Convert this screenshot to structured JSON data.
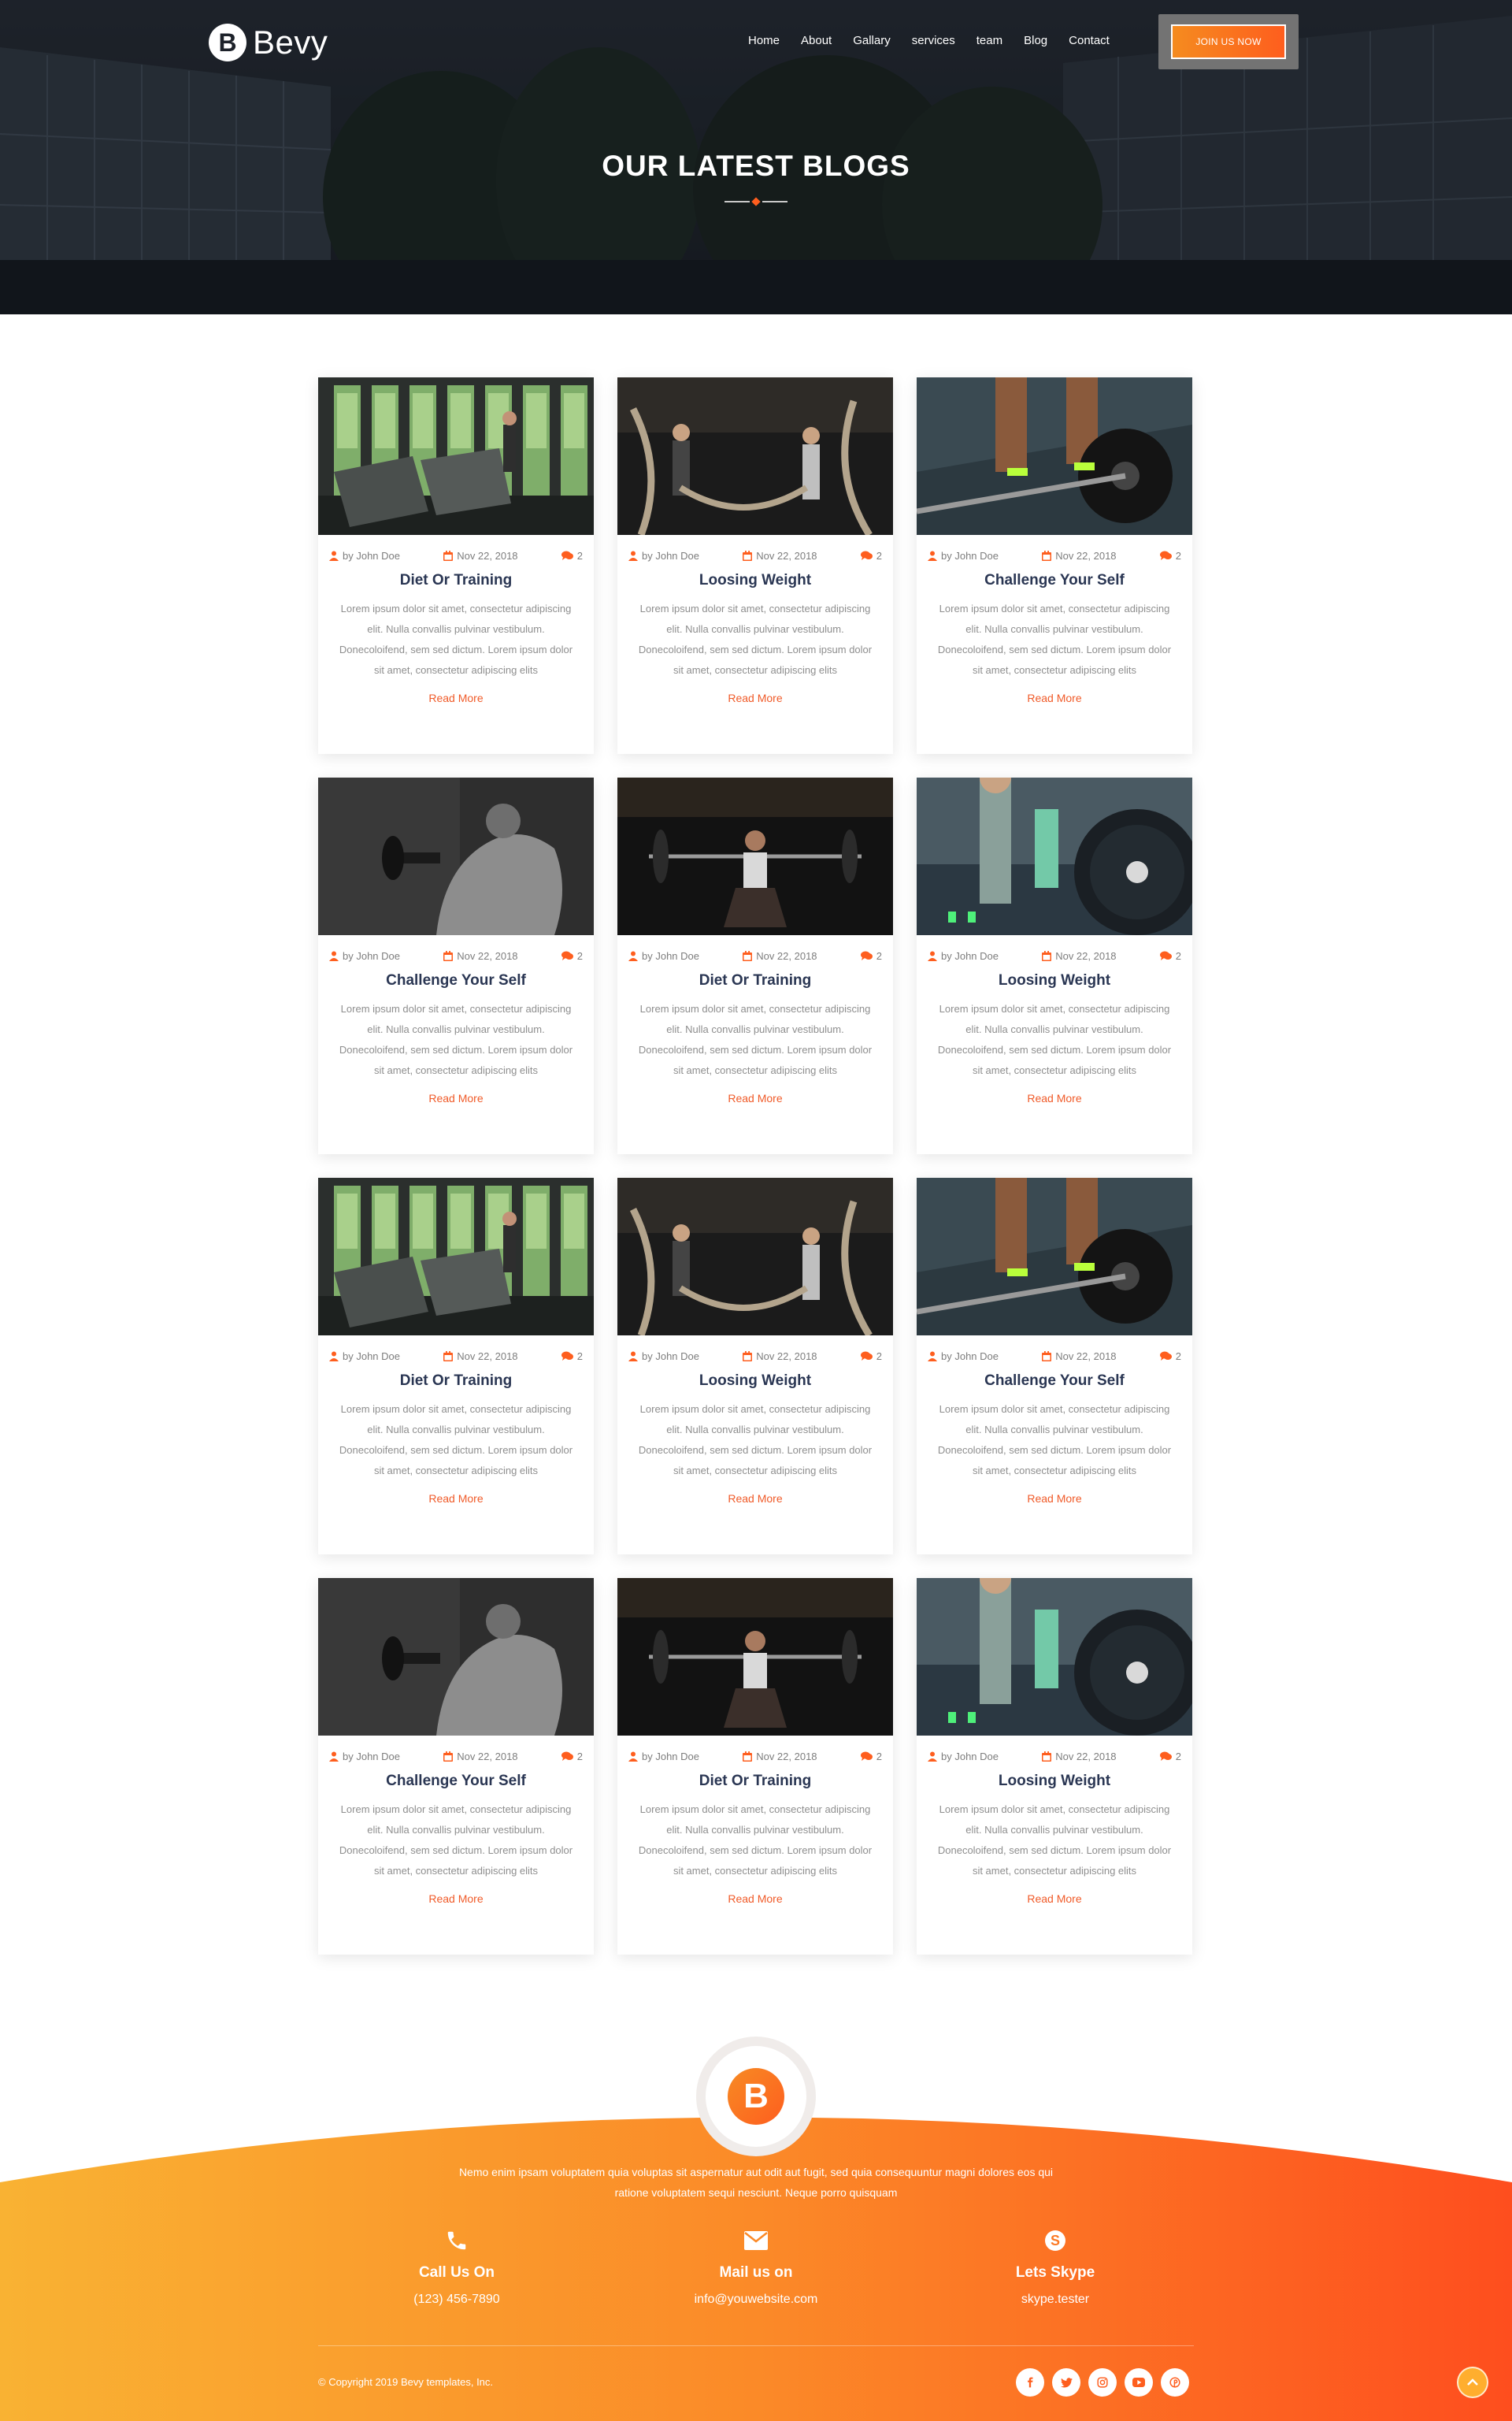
{
  "header": {
    "logo_text": "Bevy",
    "logo_letter": "B",
    "nav": [
      "Home",
      "About",
      "Gallary",
      "services",
      "team",
      "Blog",
      "Contact"
    ],
    "cta": "JOIN US NOW",
    "hero_title": "OUR LATEST BLOGS"
  },
  "cards": [
    {
      "img": "treadmill",
      "author": "by John Doe",
      "date": "Nov 22, 2018",
      "comments": "2",
      "title": "Diet Or Training",
      "text": "Lorem ipsum dolor sit amet, consectetur adipiscing elit. Nulla convallis pulvinar vestibulum. Donecoloifend, sem sed dictum. Lorem ipsum dolor sit amet, consectetur adipiscing elits",
      "link": "Read More"
    },
    {
      "img": "ropes",
      "author": "by John Doe",
      "date": "Nov 22, 2018",
      "comments": "2",
      "title": "Loosing Weight",
      "text": "Lorem ipsum dolor sit amet, consectetur adipiscing elit. Nulla convallis pulvinar vestibulum. Donecoloifend, sem sed dictum. Lorem ipsum dolor sit amet, consectetur adipiscing elits",
      "link": "Read More"
    },
    {
      "img": "barbell",
      "author": "by John Doe",
      "date": "Nov 22, 2018",
      "comments": "2",
      "title": "Challenge Your Self",
      "text": "Lorem ipsum dolor sit amet, consectetur adipiscing elit. Nulla convallis pulvinar vestibulum. Donecoloifend, sem sed dictum. Lorem ipsum dolor sit amet, consectetur adipiscing elits",
      "link": "Read More"
    },
    {
      "img": "dumbbell",
      "author": "by John Doe",
      "date": "Nov 22, 2018",
      "comments": "2",
      "title": "Challenge Your Self",
      "text": "Lorem ipsum dolor sit amet, consectetur adipiscing elit. Nulla convallis pulvinar vestibulum. Donecoloifend, sem sed dictum. Lorem ipsum dolor sit amet, consectetur adipiscing elits",
      "link": "Read More"
    },
    {
      "img": "squat",
      "author": "by John Doe",
      "date": "Nov 22, 2018",
      "comments": "2",
      "title": "Diet Or Training",
      "text": "Lorem ipsum dolor sit amet, consectetur adipiscing elit. Nulla convallis pulvinar vestibulum. Donecoloifend, sem sed dictum. Lorem ipsum dolor sit amet, consectetur adipiscing elits",
      "link": "Read More"
    },
    {
      "img": "plates",
      "author": "by John Doe",
      "date": "Nov 22, 2018",
      "comments": "2",
      "title": "Loosing Weight",
      "text": "Lorem ipsum dolor sit amet, consectetur adipiscing elit. Nulla convallis pulvinar vestibulum. Donecoloifend, sem sed dictum. Lorem ipsum dolor sit amet, consectetur adipiscing elits",
      "link": "Read More"
    },
    {
      "img": "treadmill",
      "author": "by John Doe",
      "date": "Nov 22, 2018",
      "comments": "2",
      "title": "Diet Or Training",
      "text": "Lorem ipsum dolor sit amet, consectetur adipiscing elit. Nulla convallis pulvinar vestibulum. Donecoloifend, sem sed dictum. Lorem ipsum dolor sit amet, consectetur adipiscing elits",
      "link": "Read More"
    },
    {
      "img": "ropes",
      "author": "by John Doe",
      "date": "Nov 22, 2018",
      "comments": "2",
      "title": "Loosing Weight",
      "text": "Lorem ipsum dolor sit amet, consectetur adipiscing elit. Nulla convallis pulvinar vestibulum. Donecoloifend, sem sed dictum. Lorem ipsum dolor sit amet, consectetur adipiscing elits",
      "link": "Read More"
    },
    {
      "img": "barbell",
      "author": "by John Doe",
      "date": "Nov 22, 2018",
      "comments": "2",
      "title": "Challenge Your Self",
      "text": "Lorem ipsum dolor sit amet, consectetur adipiscing elit. Nulla convallis pulvinar vestibulum. Donecoloifend, sem sed dictum. Lorem ipsum dolor sit amet, consectetur adipiscing elits",
      "link": "Read More"
    },
    {
      "img": "dumbbell",
      "author": "by John Doe",
      "date": "Nov 22, 2018",
      "comments": "2",
      "title": "Challenge Your Self",
      "text": "Lorem ipsum dolor sit amet, consectetur adipiscing elit. Nulla convallis pulvinar vestibulum. Donecoloifend, sem sed dictum. Lorem ipsum dolor sit amet, consectetur adipiscing elits",
      "link": "Read More"
    },
    {
      "img": "squat",
      "author": "by John Doe",
      "date": "Nov 22, 2018",
      "comments": "2",
      "title": "Diet Or Training",
      "text": "Lorem ipsum dolor sit amet, consectetur adipiscing elit. Nulla convallis pulvinar vestibulum. Donecoloifend, sem sed dictum. Lorem ipsum dolor sit amet, consectetur adipiscing elits",
      "link": "Read More"
    },
    {
      "img": "plates",
      "author": "by John Doe",
      "date": "Nov 22, 2018",
      "comments": "2",
      "title": "Loosing Weight",
      "text": "Lorem ipsum dolor sit amet, consectetur adipiscing elit. Nulla convallis pulvinar vestibulum. Donecoloifend, sem sed dictum. Lorem ipsum dolor sit amet, consectetur adipiscing elits",
      "link": "Read More"
    }
  ],
  "footer": {
    "description": "Nemo enim ipsam voluptatem quia voluptas sit aspernatur aut odit aut fugit, sed quia consequuntur magni dolores eos qui ratione voluptatem sequi nesciunt. Neque porro quisquam",
    "contacts": [
      {
        "icon": "phone-icon",
        "title": "Call Us On",
        "value": "(123) 456-7890"
      },
      {
        "icon": "envelope-icon",
        "title": "Mail us on",
        "value": "info@youwebsite.com"
      },
      {
        "icon": "skype-icon",
        "title": "Lets Skype",
        "value": "skype.tester"
      }
    ],
    "copyright": "© Copyright 2019 Bevy templates, Inc.",
    "socials": [
      "facebook-icon",
      "twitter-icon",
      "instagram-icon",
      "youtube-icon",
      "pinterest-icon"
    ]
  },
  "colors": {
    "accent": "#fe5e1e",
    "accent_light": "#f9b233",
    "title_text": "#2a3653",
    "body_text": "#8e8e8e",
    "link": "#f05a28"
  }
}
